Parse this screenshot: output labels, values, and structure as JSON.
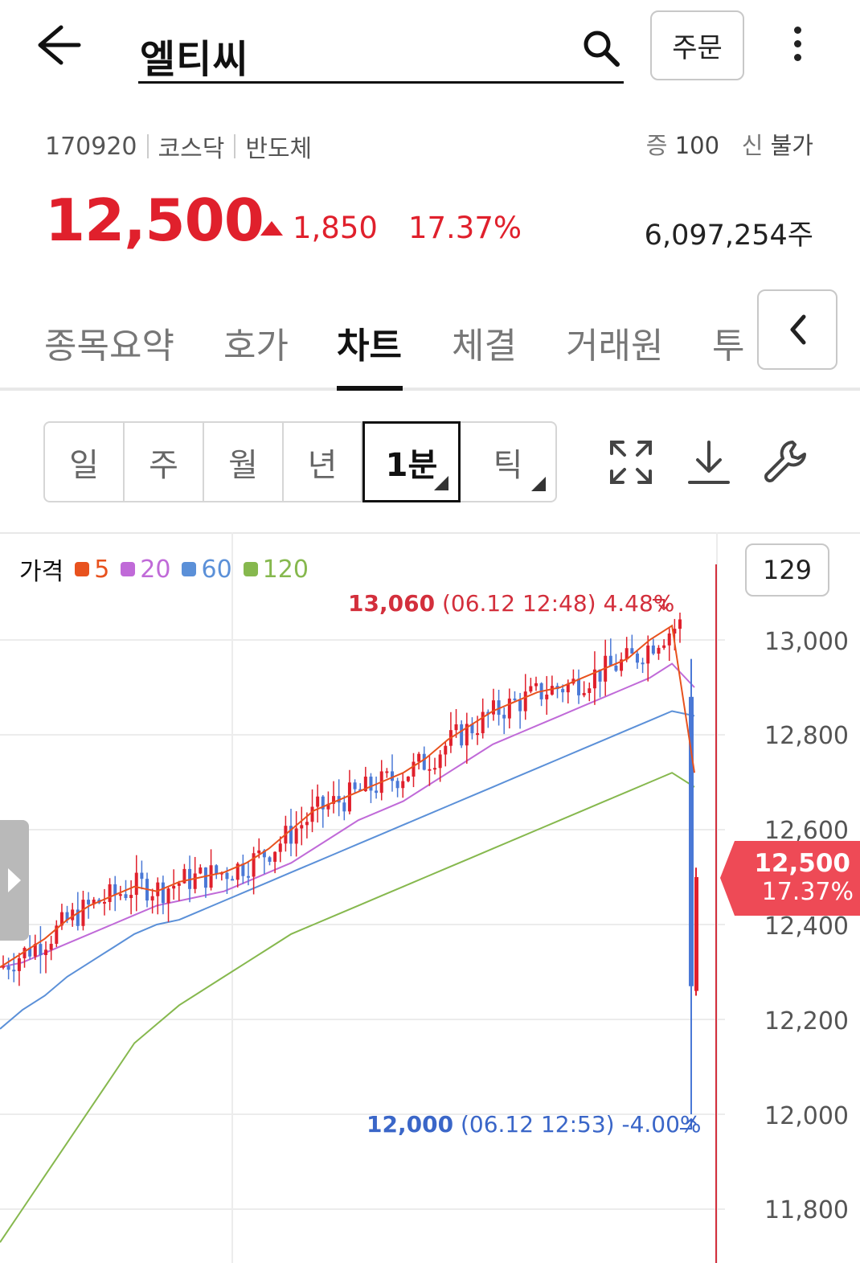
{
  "header": {
    "search_text": "엘티씨",
    "order_label": "주문",
    "icons": [
      "back-arrow-icon",
      "search-icon",
      "more-vertical-icon"
    ]
  },
  "stock": {
    "code": "170920",
    "market": "코스닥",
    "sector": "반도체",
    "margin_label": "증",
    "margin_value": "100",
    "credit_label": "신",
    "credit_value": "불가",
    "price": "12,500",
    "change": "1,850",
    "change_pct": "17.37%",
    "volume": "6,097,254주"
  },
  "tabs": [
    {
      "label": "종목요약",
      "active": false
    },
    {
      "label": "호가",
      "active": false
    },
    {
      "label": "차트",
      "active": true
    },
    {
      "label": "체결",
      "active": false
    },
    {
      "label": "거래원",
      "active": false
    },
    {
      "label": "투",
      "active": false
    }
  ],
  "periods": [
    {
      "label": "일",
      "active": false,
      "has_menu": false
    },
    {
      "label": "주",
      "active": false,
      "has_menu": false
    },
    {
      "label": "월",
      "active": false,
      "has_menu": false
    },
    {
      "label": "년",
      "active": false,
      "has_menu": false
    },
    {
      "label": "1분",
      "active": true,
      "has_menu": true
    },
    {
      "label": "틱",
      "active": false,
      "has_menu": true
    }
  ],
  "toolbar_icons": [
    "expand-icon",
    "download-icon",
    "wrench-icon"
  ],
  "chart": {
    "legend_title": "가격",
    "count": "129",
    "high_price": "13,060",
    "high_info": " (06.12 12:48) 4.48%",
    "low_price": "12,000",
    "low_info": " (06.12 12:53) -4.00%",
    "current_price": "12,500",
    "current_pct": "17.37%",
    "colors": {
      "up": "#e0202c",
      "down": "#4a78d6",
      "ma5": "#e8521e",
      "ma20": "#c06ad8",
      "ma60": "#5b90d8",
      "ma120": "#86b84e"
    }
  },
  "chart_data": {
    "type": "candlestick",
    "title": "",
    "series": [
      {
        "name": "5",
        "color": "#e8521e"
      },
      {
        "name": "20",
        "color": "#c06ad8"
      },
      {
        "name": "60",
        "color": "#5b90d8"
      },
      {
        "name": "120",
        "color": "#86b84e"
      }
    ],
    "y_ticks": [
      "13,000",
      "12,800",
      "12,600",
      "12,400",
      "12,200",
      "12,000",
      "11,800"
    ],
    "ylim": [
      11750,
      13200
    ],
    "ma_lines": {
      "ma5": [
        12310,
        12340,
        12370,
        12410,
        12440,
        12460,
        12480,
        12470,
        12490,
        12500,
        12510,
        12530,
        12560,
        12600,
        12640,
        12660,
        12680,
        12700,
        12720,
        12750,
        12790,
        12820,
        12850,
        12870,
        12890,
        12900,
        12920,
        12940,
        12960,
        13000,
        13030,
        12720
      ],
      "ma20": [
        12310,
        12320,
        12340,
        12360,
        12380,
        12400,
        12420,
        12440,
        12450,
        12460,
        12470,
        12490,
        12510,
        12530,
        12560,
        12590,
        12620,
        12640,
        12660,
        12690,
        12720,
        12750,
        12780,
        12800,
        12820,
        12840,
        12860,
        12880,
        12900,
        12920,
        12950,
        12900
      ],
      "ma60": [
        12180,
        12220,
        12250,
        12290,
        12320,
        12350,
        12380,
        12400,
        12410,
        12430,
        12450,
        12470,
        12490,
        12510,
        12530,
        12550,
        12570,
        12590,
        12610,
        12630,
        12650,
        12670,
        12690,
        12710,
        12730,
        12750,
        12770,
        12790,
        12810,
        12830,
        12850,
        12840
      ],
      "ma120": [
        11730,
        11800,
        11870,
        11940,
        12010,
        12080,
        12150,
        12190,
        12230,
        12260,
        12290,
        12320,
        12350,
        12380,
        12400,
        12420,
        12440,
        12460,
        12480,
        12500,
        12520,
        12540,
        12560,
        12580,
        12600,
        12620,
        12640,
        12660,
        12680,
        12700,
        12720,
        12690
      ]
    },
    "high": {
      "price": 13060,
      "time": "06.12 12:48",
      "pct": 4.48
    },
    "low": {
      "price": 12000,
      "time": "06.12 12:53",
      "pct": -4.0
    },
    "current": 12500
  }
}
